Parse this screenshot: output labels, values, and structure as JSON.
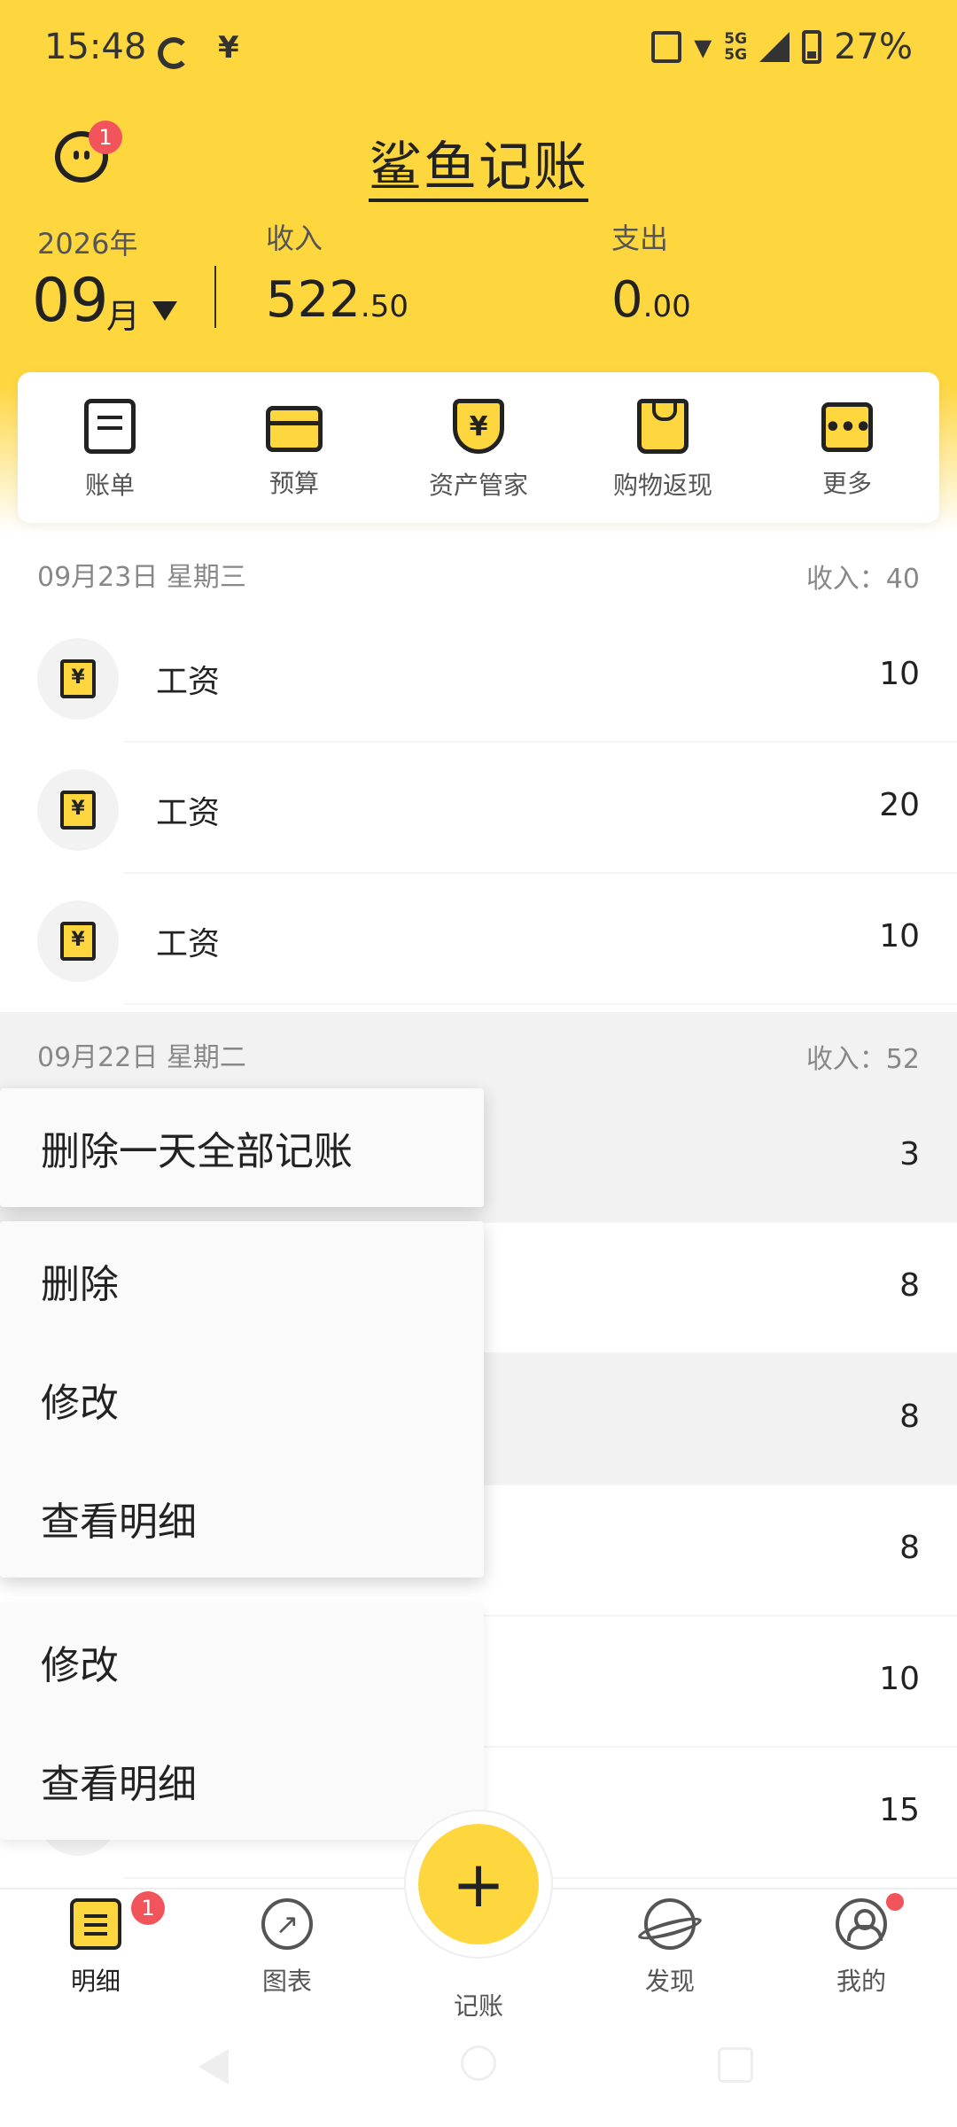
{
  "status_bar": {
    "time": "15:48",
    "network": "5G",
    "battery": "27%",
    "yen_symbol": "¥"
  },
  "header": {
    "title": "鲨鱼记账",
    "avatar_badge": "1",
    "year": "2026年",
    "month": "09",
    "month_unit": "月",
    "income_label": "收入",
    "income_int": "522",
    "income_dec": ".50",
    "expense_label": "支出",
    "expense_int": "0",
    "expense_dec": ".00"
  },
  "quick_menu": [
    {
      "label": "账单",
      "icon": "bill-icon"
    },
    {
      "label": "预算",
      "icon": "wallet-icon"
    },
    {
      "label": "资产管家",
      "icon": "shield-yen-icon"
    },
    {
      "label": "购物返现",
      "icon": "shopping-bag-icon"
    },
    {
      "label": "更多",
      "icon": "more-icon"
    }
  ],
  "days": [
    {
      "date": "09月23日 星期三",
      "income": "收入：40",
      "records": [
        {
          "name": "工资",
          "amount": "10",
          "icon": "salary-icon"
        },
        {
          "name": "工资",
          "amount": "20",
          "icon": "salary-icon"
        },
        {
          "name": "工资",
          "amount": "10",
          "icon": "salary-icon"
        }
      ]
    },
    {
      "date": "09月22日 星期二",
      "income": "收入：52",
      "records": [
        {
          "amount": "3"
        },
        {
          "amount": "8"
        },
        {
          "amount": "8"
        },
        {
          "amount": "8"
        },
        {
          "amount": "10"
        },
        {
          "amount": "15"
        }
      ]
    }
  ],
  "context_menus": {
    "top": {
      "items": [
        "删除一天全部记账"
      ]
    },
    "middle": {
      "items": [
        "删除",
        "修改",
        "查看明细"
      ]
    },
    "bottom": {
      "items": [
        "修改",
        "查看明细"
      ]
    }
  },
  "fab": {
    "symbol": "+"
  },
  "bottom_nav": [
    {
      "label": "明细",
      "icon": "detail-icon",
      "badge": "1"
    },
    {
      "label": "图表",
      "icon": "chart-icon"
    },
    {
      "label": "记账",
      "icon": "add-icon"
    },
    {
      "label": "发现",
      "icon": "planet-icon"
    },
    {
      "label": "我的",
      "icon": "profile-icon"
    }
  ],
  "colors": {
    "brand_yellow": "#fed63e",
    "badge_red": "#f2545b",
    "text_dark": "#222222",
    "text_gray": "#888888"
  }
}
